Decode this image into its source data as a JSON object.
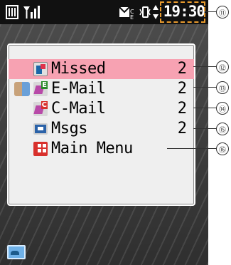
{
  "status_bar": {
    "time": "19:30",
    "icons": [
      "battery-icon",
      "signal-icon",
      "mail-icon",
      "vibrate-icon",
      "sync-icon"
    ]
  },
  "menu": {
    "items": [
      {
        "label": "Missed",
        "count": "2",
        "icon": "missed-call-icon",
        "selected": true,
        "callout": "⑫"
      },
      {
        "label": "E-Mail",
        "count": "2",
        "icon": "email-icon",
        "selected": false,
        "callout": "⑬"
      },
      {
        "label": "C-Mail",
        "count": "2",
        "icon": "cmail-icon",
        "selected": false,
        "callout": "⑭"
      },
      {
        "label": "Msgs",
        "count": "2",
        "icon": "messages-icon",
        "selected": false,
        "callout": "⑮"
      },
      {
        "label": "Main Menu",
        "count": "",
        "icon": "main-menu-icon",
        "selected": false,
        "callout": "⑯"
      }
    ]
  },
  "callouts": {
    "time": "⑪"
  },
  "colors": {
    "selected_row": "#f7a2b2",
    "callout_box": "#e89a2d"
  }
}
